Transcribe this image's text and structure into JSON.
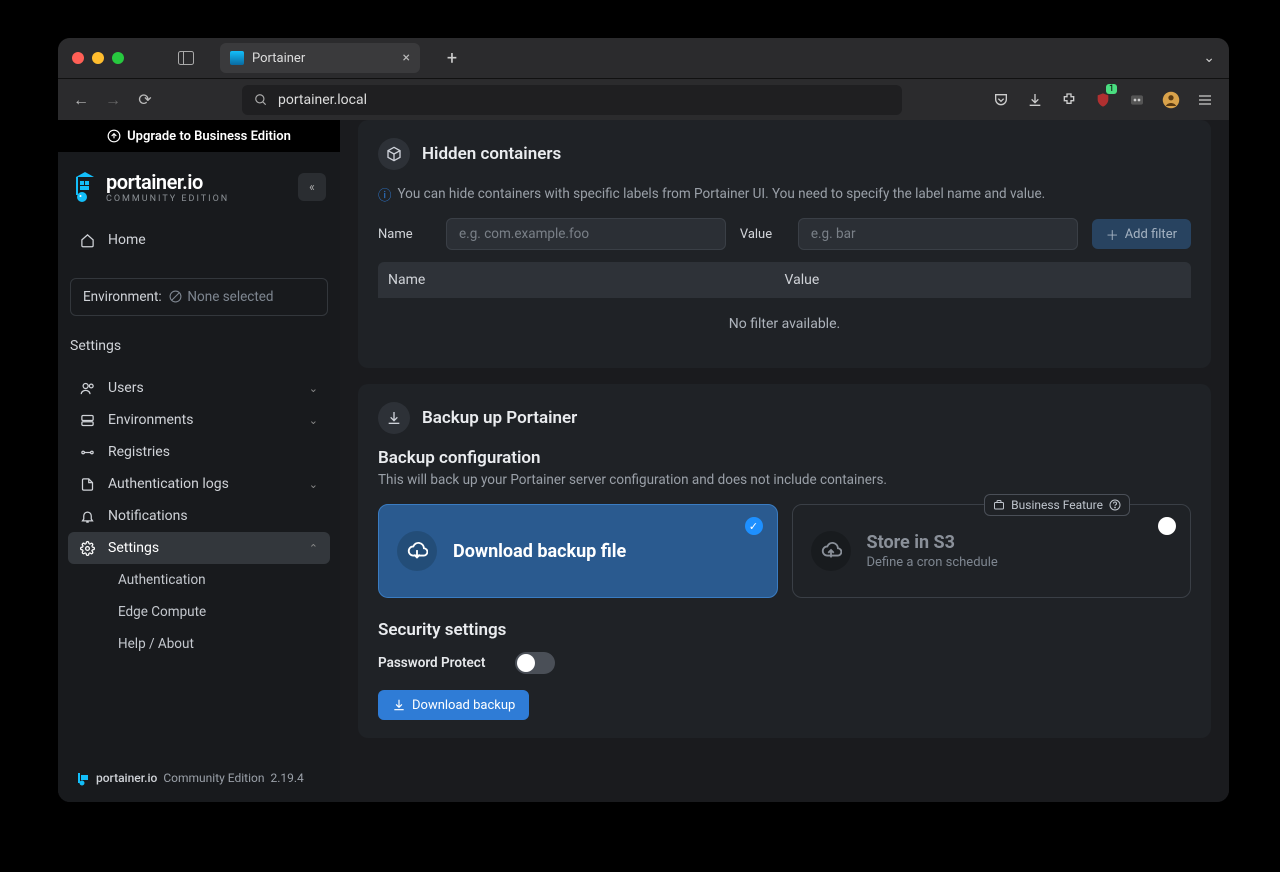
{
  "browser": {
    "tab_title": "Portainer",
    "address": "portainer.local"
  },
  "sidebar": {
    "upgrade_banner": "Upgrade to Business Edition",
    "brand": "portainer.io",
    "edition": "COMMUNITY EDITION",
    "home_label": "Home",
    "env_label": "Environment:",
    "env_value": "None selected",
    "section_header": "Settings",
    "items": {
      "users": "Users",
      "environments": "Environments",
      "registries": "Registries",
      "authlogs": "Authentication logs",
      "notifications": "Notifications",
      "settings": "Settings",
      "sub_authentication": "Authentication",
      "sub_edge": "Edge Compute",
      "sub_help": "Help / About"
    },
    "footer_brand": "portainer.io",
    "footer_edition": "Community Edition",
    "footer_version": "2.19.4"
  },
  "hidden_panel": {
    "title": "Hidden containers",
    "info": "You can hide containers with specific labels from Portainer UI. You need to specify the label name and value.",
    "name_label": "Name",
    "name_placeholder": "e.g. com.example.foo",
    "value_label": "Value",
    "value_placeholder": "e.g. bar",
    "add_filter": "Add filter",
    "col_name": "Name",
    "col_value": "Value",
    "empty": "No filter available."
  },
  "backup_panel": {
    "title": "Backup up Portainer",
    "config_heading": "Backup configuration",
    "config_desc": "This will back up your Portainer server configuration and does not include containers.",
    "card_download": "Download backup file",
    "card_s3_title": "Store in S3",
    "card_s3_sub": "Define a cron schedule",
    "biz_badge": "Business Feature",
    "security_heading": "Security settings",
    "password_protect": "Password Protect",
    "download_button": "Download backup"
  }
}
